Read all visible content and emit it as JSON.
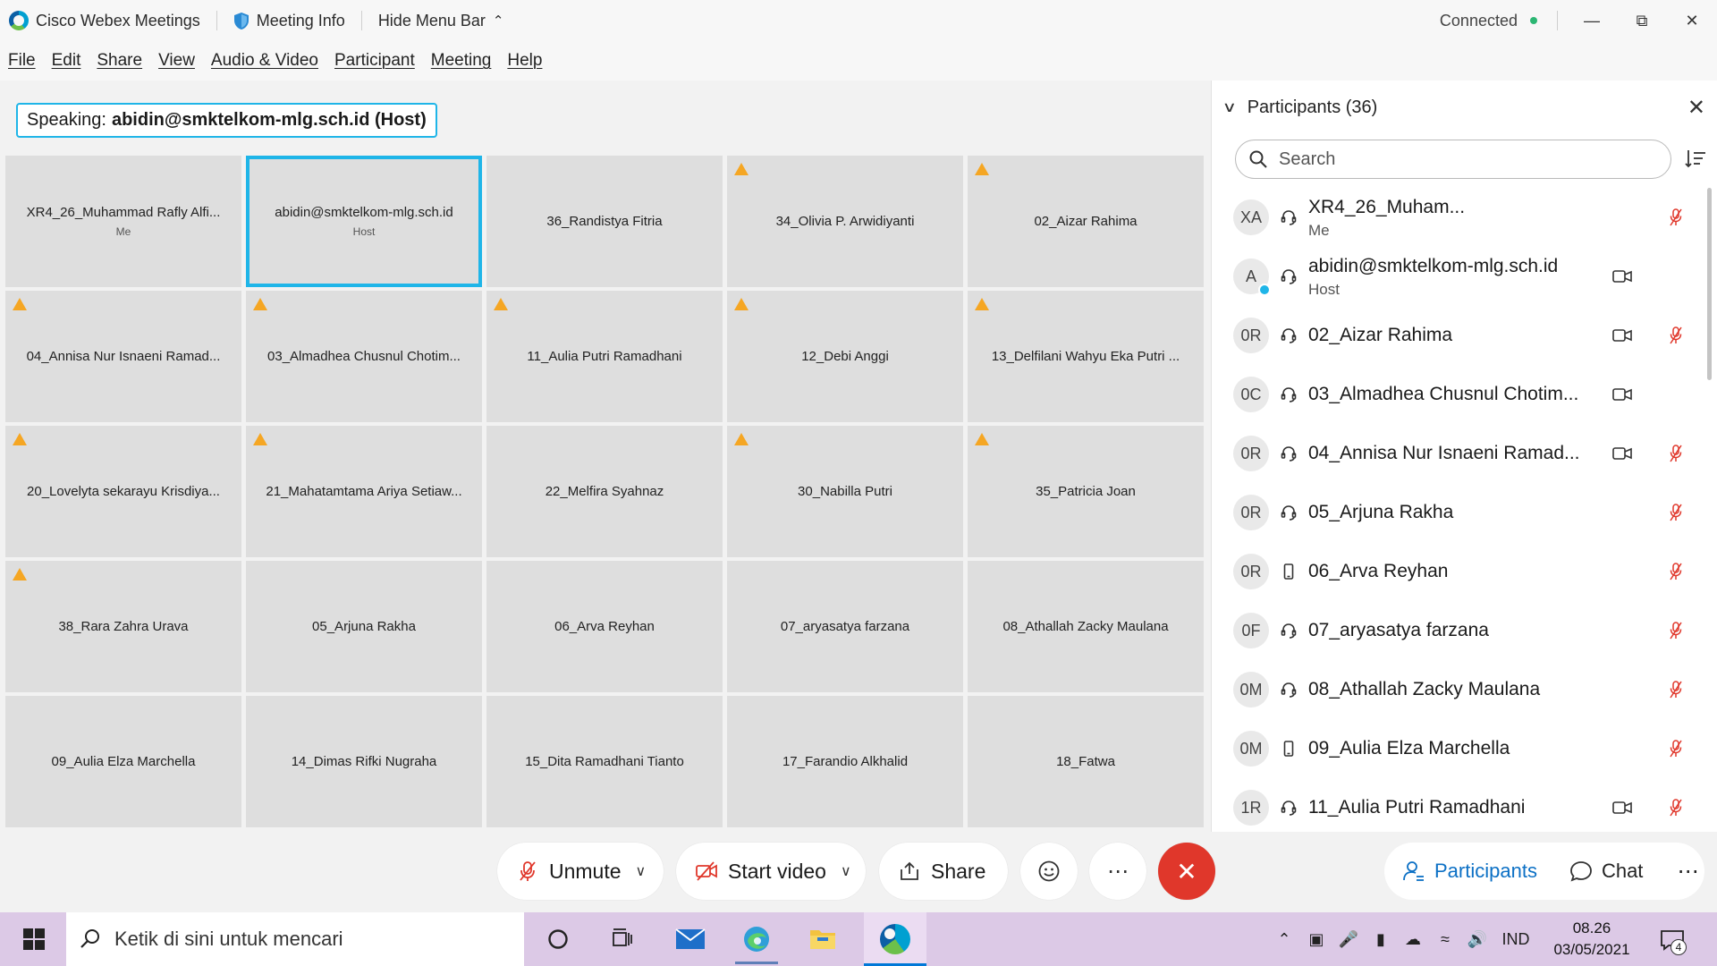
{
  "titlebar": {
    "app_title": "Cisco Webex Meetings",
    "meeting_info": "Meeting Info",
    "hide_menu": "Hide Menu Bar",
    "status": "Connected",
    "status_color": "#2bb673"
  },
  "menu": [
    "File",
    "Edit",
    "Share",
    "View",
    "Audio & Video",
    "Participant",
    "Meeting",
    "Help"
  ],
  "speaking": {
    "label": "Speaking:",
    "name": "abidin@smktelkom-mlg.sch.id (Host)"
  },
  "tiles": [
    {
      "name": "XR4_26_Muhammad Rafly Alfi...",
      "role": "Me",
      "warn": false,
      "active": false
    },
    {
      "name": "abidin@smktelkom-mlg.sch.id",
      "role": "Host",
      "warn": false,
      "active": true
    },
    {
      "name": "36_Randistya Fitria",
      "role": "",
      "warn": false,
      "active": false
    },
    {
      "name": "34_Olivia P. Arwidiyanti",
      "role": "",
      "warn": true,
      "active": false
    },
    {
      "name": "02_Aizar Rahima",
      "role": "",
      "warn": true,
      "active": false
    },
    {
      "name": "04_Annisa Nur Isnaeni Ramad...",
      "role": "",
      "warn": true,
      "active": false
    },
    {
      "name": "03_Almadhea Chusnul Chotim...",
      "role": "",
      "warn": true,
      "active": false
    },
    {
      "name": "11_Aulia Putri Ramadhani",
      "role": "",
      "warn": true,
      "active": false
    },
    {
      "name": "12_Debi Anggi",
      "role": "",
      "warn": true,
      "active": false
    },
    {
      "name": "13_Delfilani Wahyu Eka Putri ...",
      "role": "",
      "warn": true,
      "active": false
    },
    {
      "name": "20_Lovelyta sekarayu Krisdiya...",
      "role": "",
      "warn": true,
      "active": false
    },
    {
      "name": "21_Mahatamtama Ariya Setiaw...",
      "role": "",
      "warn": true,
      "active": false
    },
    {
      "name": "22_Melfira Syahnaz",
      "role": "",
      "warn": false,
      "active": false
    },
    {
      "name": "30_Nabilla Putri",
      "role": "",
      "warn": true,
      "active": false
    },
    {
      "name": "35_Patricia Joan",
      "role": "",
      "warn": true,
      "active": false
    },
    {
      "name": "38_Rara Zahra Urava",
      "role": "",
      "warn": true,
      "active": false
    },
    {
      "name": "05_Arjuna Rakha",
      "role": "",
      "warn": false,
      "active": false
    },
    {
      "name": "06_Arva Reyhan",
      "role": "",
      "warn": false,
      "active": false
    },
    {
      "name": "07_aryasatya farzana",
      "role": "",
      "warn": false,
      "active": false
    },
    {
      "name": "08_Athallah Zacky Maulana",
      "role": "",
      "warn": false,
      "active": false
    },
    {
      "name": "09_Aulia Elza Marchella",
      "role": "",
      "warn": false,
      "active": false
    },
    {
      "name": "14_Dimas Rifki Nugraha",
      "role": "",
      "warn": false,
      "active": false
    },
    {
      "name": "15_Dita Ramadhani Tianto",
      "role": "",
      "warn": false,
      "active": false
    },
    {
      "name": "17_Farandio Alkhalid",
      "role": "",
      "warn": false,
      "active": false
    },
    {
      "name": "18_Fatwa",
      "role": "",
      "warn": false,
      "active": false
    }
  ],
  "panel": {
    "title": "Participants (36)",
    "search_placeholder": "Search",
    "participants": [
      {
        "initials": "XA",
        "device": "headset",
        "name": "XR4_26_Muham...",
        "role": "Me",
        "camera": false,
        "muted": true,
        "badge": false
      },
      {
        "initials": "A",
        "device": "headset",
        "name": "abidin@smktelkom-mlg.sch.id",
        "role": "Host",
        "camera": true,
        "muted": false,
        "badge": true
      },
      {
        "initials": "0R",
        "device": "headset",
        "name": "02_Aizar Rahima",
        "role": "",
        "camera": true,
        "muted": true,
        "badge": false
      },
      {
        "initials": "0C",
        "device": "headset",
        "name": "03_Almadhea Chusnul Chotim...",
        "role": "",
        "camera": true,
        "muted": false,
        "badge": false
      },
      {
        "initials": "0R",
        "device": "headset",
        "name": "04_Annisa Nur Isnaeni Ramad...",
        "role": "",
        "camera": true,
        "muted": true,
        "badge": false
      },
      {
        "initials": "0R",
        "device": "headset",
        "name": "05_Arjuna Rakha",
        "role": "",
        "camera": false,
        "muted": true,
        "badge": false
      },
      {
        "initials": "0R",
        "device": "phone",
        "name": "06_Arva Reyhan",
        "role": "",
        "camera": false,
        "muted": true,
        "badge": false
      },
      {
        "initials": "0F",
        "device": "headset",
        "name": "07_aryasatya farzana",
        "role": "",
        "camera": false,
        "muted": true,
        "badge": false
      },
      {
        "initials": "0M",
        "device": "headset",
        "name": "08_Athallah Zacky Maulana",
        "role": "",
        "camera": false,
        "muted": true,
        "badge": false
      },
      {
        "initials": "0M",
        "device": "phone",
        "name": "09_Aulia Elza Marchella",
        "role": "",
        "camera": false,
        "muted": true,
        "badge": false
      },
      {
        "initials": "1R",
        "device": "headset",
        "name": "11_Aulia Putri Ramadhani",
        "role": "",
        "camera": true,
        "muted": true,
        "badge": false
      }
    ]
  },
  "controls": {
    "unmute": "Unmute",
    "start_video": "Start video",
    "share": "Share",
    "participants": "Participants",
    "chat": "Chat",
    "leave_color": "#e0372b",
    "accent_color": "#0c70c5"
  },
  "taskbar": {
    "search_placeholder": "Ketik di sini untuk mencari",
    "language": "IND",
    "time": "08.26",
    "date": "03/05/2021",
    "notifications": "4"
  }
}
